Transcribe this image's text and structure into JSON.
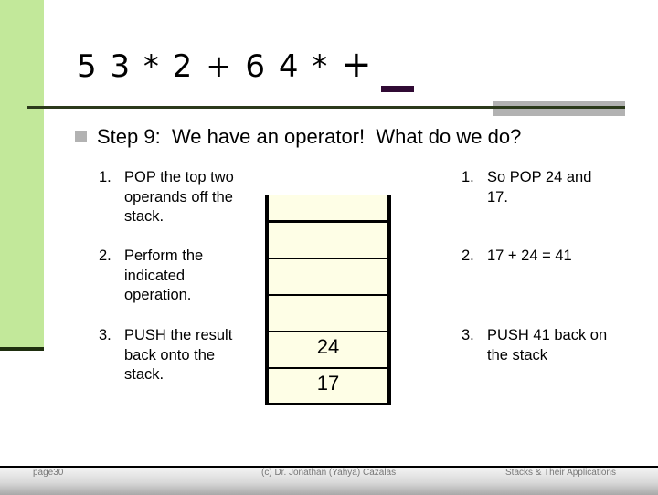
{
  "slide": {
    "title_tokens": "5 3 * 2 + 6 4 * ",
    "title_current_token": "+",
    "heading": "Step 9:  We have an operator!  What do we do?",
    "left_steps": [
      {
        "num": "1.",
        "text": "POP the top two operands off the stack."
      },
      {
        "num": "2.",
        "text": "Perform the indicated operation."
      },
      {
        "num": "3.",
        "text": "PUSH the result back onto the stack."
      }
    ],
    "right_steps": [
      {
        "num": "1.",
        "text": "So POP 24 and 17."
      },
      {
        "num": "2.",
        "text": "17 + 24 = 41"
      },
      {
        "num": "3.",
        "text": "PUSH 41 back on the stack"
      }
    ],
    "stack": {
      "cells_top_to_bottom": [
        "",
        "",
        "",
        "",
        "24",
        "17"
      ]
    },
    "colors": {
      "accent_green": "#c2e89a",
      "stack_fill": "#fefee6",
      "current_token_mark": "#300a34",
      "bullet_gray": "#b2b2b2"
    }
  },
  "footer": {
    "page": "page30",
    "author": "(c) Dr. Jonathan (Yahya) Cazalas",
    "topic": "Stacks & Their Applications"
  }
}
